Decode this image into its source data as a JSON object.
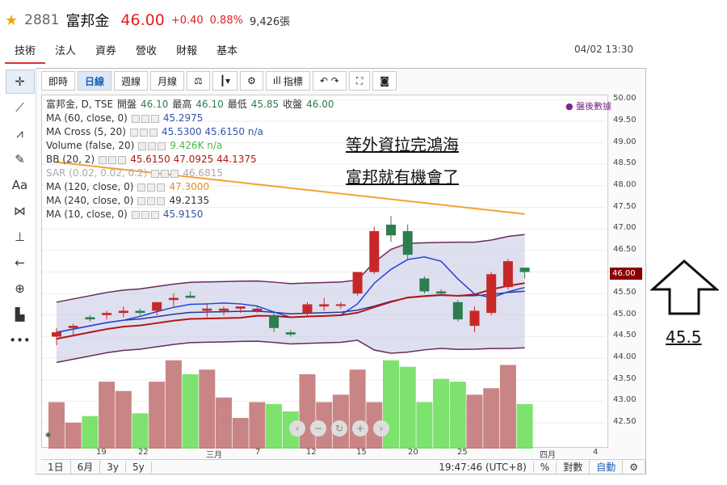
{
  "header": {
    "code": "2881",
    "name": "富邦金",
    "price": "46.00",
    "change": "+0.40",
    "change_pct": "0.88%",
    "volume": "9,426張"
  },
  "tabs": [
    "技術",
    "法人",
    "資券",
    "營收",
    "財報",
    "基本"
  ],
  "datetime": "04/02 13:30",
  "toolbar": {
    "intraday": "即時",
    "daily": "日線",
    "weekly": "週線",
    "monthly": "月線",
    "indicators": "指標"
  },
  "legend": {
    "title": "富邦金, D, TSE",
    "ohlc": {
      "open_label": "開盤",
      "open": "46.10",
      "high_label": "最高",
      "high": "46.10",
      "low_label": "最低",
      "low": "45.85",
      "close_label": "收盤",
      "close": "46.00"
    },
    "after_hours": "盤後數據",
    "rows": [
      {
        "label": "MA (60, close, 0)",
        "values": "45.2975"
      },
      {
        "label": "MA Cross (5, 20)",
        "values": "45.5300  45.6150  n/a"
      },
      {
        "label": "Volume (false, 20)",
        "values": "9.426K  n/a"
      },
      {
        "label": "BB (20, 2)",
        "values": "45.6150  47.0925  44.1375"
      },
      {
        "label": "SAR (0.02, 0.02, 0.2)",
        "values": "46.6815"
      },
      {
        "label": "MA (120, close, 0)",
        "values": "47.3000"
      },
      {
        "label": "MA (240, close, 0)",
        "values": "49.2135"
      },
      {
        "label": "MA (10, close, 0)",
        "values": "45.9150"
      }
    ]
  },
  "annotations": {
    "line1": "等外資拉完鴻海",
    "line2": "富邦就有機會了",
    "target": "45.5"
  },
  "bottom": {
    "ranges": [
      "1日",
      "6月",
      "3y",
      "5y"
    ],
    "time": "19:47:46 (UTC+8)",
    "pct": "%",
    "log": "對數",
    "auto": "自動"
  },
  "colors": {
    "up": "#c62828",
    "down": "#2e7d4f",
    "vol_up": "#c07070",
    "vol_down": "#66dd55",
    "bb_fill": "#c8cbe6",
    "ma240": "#f5a030",
    "ma60": "#b01818",
    "ma5": "#2244dd",
    "ma20": "#333388"
  },
  "chart_data": {
    "type": "candlestick",
    "ylim": [
      41.9,
      50.1
    ],
    "yticks": [
      42.5,
      43.0,
      43.5,
      44.0,
      44.5,
      45.0,
      45.5,
      46.0,
      46.5,
      47.0,
      47.5,
      48.0,
      48.5,
      49.0,
      49.5,
      50.0
    ],
    "xtick_labels": [
      "19",
      "22",
      "三月",
      "7",
      "12",
      "15",
      "20",
      "25",
      "四月",
      "4"
    ],
    "last_price": "46.00",
    "candles": [
      {
        "o": 44.5,
        "h": 44.7,
        "l": 44.3,
        "c": 44.6
      },
      {
        "o": 44.7,
        "h": 44.8,
        "l": 44.5,
        "c": 44.75
      },
      {
        "o": 44.95,
        "h": 45.0,
        "l": 44.85,
        "c": 44.9
      },
      {
        "o": 45.0,
        "h": 45.1,
        "l": 44.9,
        "c": 45.05
      },
      {
        "o": 45.05,
        "h": 45.2,
        "l": 44.95,
        "c": 45.1
      },
      {
        "o": 45.1,
        "h": 45.15,
        "l": 45.0,
        "c": 45.05
      },
      {
        "o": 45.1,
        "h": 45.3,
        "l": 45.0,
        "c": 45.3
      },
      {
        "o": 45.35,
        "h": 45.5,
        "l": 45.2,
        "c": 45.4
      },
      {
        "o": 45.45,
        "h": 45.55,
        "l": 45.4,
        "c": 45.4
      },
      {
        "o": 45.1,
        "h": 45.25,
        "l": 44.95,
        "c": 45.15
      },
      {
        "o": 45.1,
        "h": 45.2,
        "l": 45.0,
        "c": 45.15
      },
      {
        "o": 45.15,
        "h": 45.2,
        "l": 45.05,
        "c": 45.2
      },
      {
        "o": 45.1,
        "h": 45.2,
        "l": 45.05,
        "c": 45.15
      },
      {
        "o": 45.0,
        "h": 45.1,
        "l": 44.6,
        "c": 44.7
      },
      {
        "o": 44.6,
        "h": 44.65,
        "l": 44.5,
        "c": 44.55
      },
      {
        "o": 45.05,
        "h": 45.3,
        "l": 44.95,
        "c": 45.25
      },
      {
        "o": 45.2,
        "h": 45.4,
        "l": 45.1,
        "c": 45.25
      },
      {
        "o": 45.25,
        "h": 45.3,
        "l": 45.15,
        "c": 45.25
      },
      {
        "o": 45.5,
        "h": 46.0,
        "l": 45.45,
        "c": 46.0
      },
      {
        "o": 46.0,
        "h": 47.05,
        "l": 45.95,
        "c": 46.95
      },
      {
        "o": 47.1,
        "h": 47.3,
        "l": 46.7,
        "c": 46.85
      },
      {
        "o": 46.95,
        "h": 47.1,
        "l": 46.3,
        "c": 46.4
      },
      {
        "o": 45.85,
        "h": 45.9,
        "l": 45.5,
        "c": 45.55
      },
      {
        "o": 45.55,
        "h": 45.6,
        "l": 45.45,
        "c": 45.5
      },
      {
        "o": 45.3,
        "h": 45.35,
        "l": 44.85,
        "c": 44.9
      },
      {
        "o": 44.75,
        "h": 45.2,
        "l": 44.6,
        "c": 45.1
      },
      {
        "o": 45.05,
        "h": 46.0,
        "l": 45.0,
        "c": 45.95
      },
      {
        "o": 45.65,
        "h": 46.3,
        "l": 45.6,
        "c": 46.25
      },
      {
        "o": 46.1,
        "h": 46.1,
        "l": 45.85,
        "c": 46.0
      }
    ],
    "volume_heights": [
      0.5,
      0.28,
      0.35,
      0.72,
      0.62,
      0.38,
      0.72,
      0.95,
      0.8,
      0.85,
      0.55,
      0.33,
      0.5,
      0.48,
      0.4,
      0.8,
      0.5,
      0.58,
      0.85,
      0.5,
      0.95,
      0.88,
      0.5,
      0.75,
      0.72,
      0.58,
      0.65,
      0.9,
      0.48
    ],
    "series_names": [
      "MA 240",
      "MA 60",
      "MA 5",
      "MA 20",
      "BB upper",
      "BB lower"
    ]
  }
}
